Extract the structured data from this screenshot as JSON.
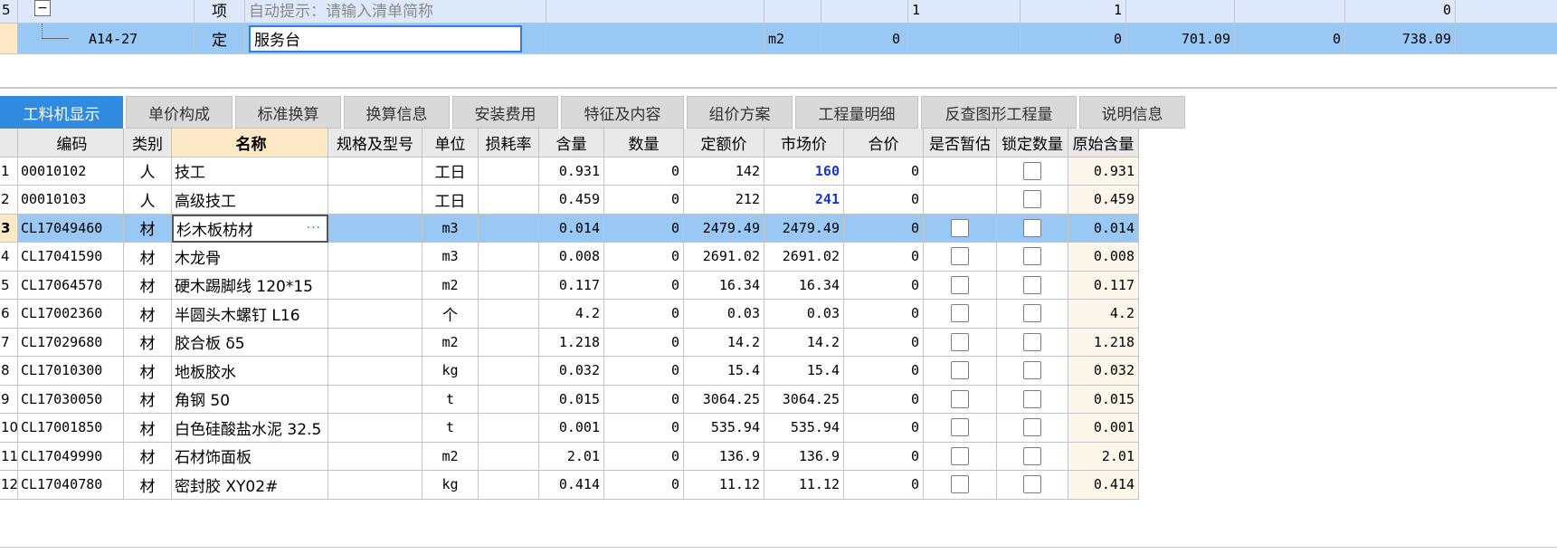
{
  "top_rows": [
    {
      "index": "5",
      "type": "项",
      "name": "自动提示：请输入清单简称",
      "n1": "1",
      "n2": "1",
      "n5": "0"
    },
    {
      "index": "",
      "code": "A14-27",
      "type": "定",
      "name": "服务台",
      "unit": "m2",
      "qty": "0",
      "n2": "0",
      "n3": "701.09",
      "n4": "0",
      "n5": "738.09"
    }
  ],
  "tabs": [
    "工料机显示",
    "单价构成",
    "标准换算",
    "换算信息",
    "安装费用",
    "特征及内容",
    "组价方案",
    "工程量明细",
    "反查图形工程量",
    "说明信息"
  ],
  "columns": [
    "编码",
    "类别",
    "名称",
    "规格及型号",
    "单位",
    "损耗率",
    "含量",
    "数量",
    "定额价",
    "市场价",
    "合价",
    "是否暂估",
    "锁定数量",
    "原始含量"
  ],
  "rows": [
    {
      "idx": "1",
      "code": "00010102",
      "cat": "人",
      "name": "技工",
      "unit": "工日",
      "content": "0.931",
      "qty": "0",
      "quota": "142",
      "market": "160",
      "total": "0",
      "orig": "0.931"
    },
    {
      "idx": "2",
      "code": "00010103",
      "cat": "人",
      "name": "高级技工",
      "unit": "工日",
      "content": "0.459",
      "qty": "0",
      "quota": "212",
      "market": "241",
      "total": "0",
      "orig": "0.459"
    },
    {
      "idx": "3",
      "code": "CL17049460",
      "cat": "材",
      "name": "杉木板枋材",
      "unit": "m3",
      "content": "0.014",
      "qty": "0",
      "quota": "2479.49",
      "market": "2479.49",
      "total": "0",
      "orig": "0.014"
    },
    {
      "idx": "4",
      "code": "CL17041590",
      "cat": "材",
      "name": "木龙骨",
      "unit": "m3",
      "content": "0.008",
      "qty": "0",
      "quota": "2691.02",
      "market": "2691.02",
      "total": "0",
      "orig": "0.008"
    },
    {
      "idx": "5",
      "code": "CL17064570",
      "cat": "材",
      "name": "硬木踢脚线 120*15",
      "unit": "m2",
      "content": "0.117",
      "qty": "0",
      "quota": "16.34",
      "market": "16.34",
      "total": "0",
      "orig": "0.117"
    },
    {
      "idx": "6",
      "code": "CL17002360",
      "cat": "材",
      "name": "半圆头木螺钉 L16",
      "unit": "个",
      "content": "4.2",
      "qty": "0",
      "quota": "0.03",
      "market": "0.03",
      "total": "0",
      "orig": "4.2"
    },
    {
      "idx": "7",
      "code": "CL17029680",
      "cat": "材",
      "name": "胶合板 δ5",
      "unit": "m2",
      "content": "1.218",
      "qty": "0",
      "quota": "14.2",
      "market": "14.2",
      "total": "0",
      "orig": "1.218"
    },
    {
      "idx": "8",
      "code": "CL17010300",
      "cat": "材",
      "name": "地板胶水",
      "unit": "kg",
      "content": "0.032",
      "qty": "0",
      "quota": "15.4",
      "market": "15.4",
      "total": "0",
      "orig": "0.032"
    },
    {
      "idx": "9",
      "code": "CL17030050",
      "cat": "材",
      "name": "角钢 50",
      "unit": "t",
      "content": "0.015",
      "qty": "0",
      "quota": "3064.25",
      "market": "3064.25",
      "total": "0",
      "orig": "0.015"
    },
    {
      "idx": "10",
      "code": "CL17001850",
      "cat": "材",
      "name": "白色硅酸盐水泥 32.5",
      "unit": "t",
      "content": "0.001",
      "qty": "0",
      "quota": "535.94",
      "market": "535.94",
      "total": "0",
      "orig": "0.001"
    },
    {
      "idx": "11",
      "code": "CL17049990",
      "cat": "材",
      "name": "石材饰面板",
      "unit": "m2",
      "content": "2.01",
      "qty": "0",
      "quota": "136.9",
      "market": "136.9",
      "total": "0",
      "orig": "2.01"
    },
    {
      "idx": "12",
      "code": "CL17040780",
      "cat": "材",
      "name": "密封胶 XY02#",
      "unit": "kg",
      "content": "0.414",
      "qty": "0",
      "quota": "11.12",
      "market": "11.12",
      "total": "0",
      "orig": "0.414"
    }
  ],
  "colors": {
    "accent": "#2f8ae0",
    "selected_row": "#99c8f4",
    "market_highlight": "#1a33d6"
  }
}
